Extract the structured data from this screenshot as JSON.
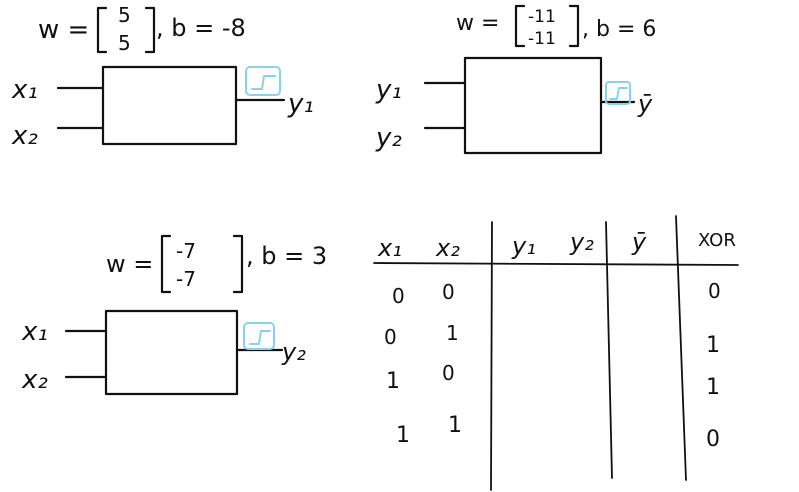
{
  "neurons": [
    {
      "id": "n1",
      "w_prefix": "w =",
      "w_top": "5",
      "w_bottom": "5",
      "b_text": ", b = -8",
      "inputs": [
        "x₁",
        "x₂"
      ],
      "output": "y₁"
    },
    {
      "id": "n2",
      "w_prefix": "w =",
      "w_top": "-11",
      "w_bottom": "-11",
      "b_text": ", b = 6",
      "inputs": [
        "y₁",
        "y₂"
      ],
      "output": "ȳ"
    },
    {
      "id": "n3",
      "w_prefix": "w =",
      "w_top": "-7",
      "w_bottom": "-7",
      "b_text": ", b = 3",
      "inputs": [
        "x₁",
        "x₂"
      ],
      "output": "y₂"
    }
  ],
  "truth_table": {
    "headers": [
      "x₁",
      "x₂",
      "y₁",
      "y₂",
      "ȳ",
      "XOR"
    ],
    "rows": [
      [
        "0",
        "0",
        "",
        "",
        "",
        "0"
      ],
      [
        "0",
        "1",
        "",
        "",
        "",
        "1"
      ],
      [
        "1",
        "0",
        "",
        "",
        "",
        "1"
      ],
      [
        "1",
        "1",
        "",
        "",
        "",
        "0"
      ]
    ]
  },
  "colors": {
    "ink": "#111111",
    "activation": "#8fd0e6",
    "background": "#ffffff"
  }
}
